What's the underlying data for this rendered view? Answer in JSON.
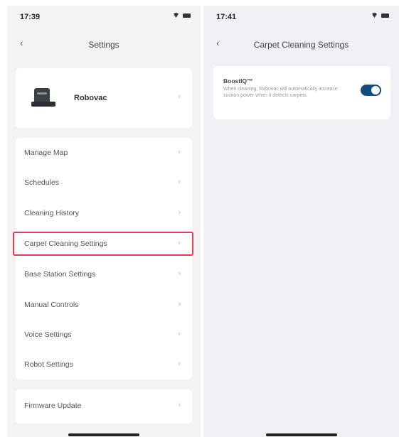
{
  "left": {
    "time": "17:39",
    "title": "Settings",
    "robot_name": "Robovac",
    "menu": [
      {
        "label": "Manage Map"
      },
      {
        "label": "Schedules"
      },
      {
        "label": "Cleaning History"
      },
      {
        "label": "Carpet Cleaning Settings",
        "highlighted": true
      },
      {
        "label": "Base Station Settings"
      },
      {
        "label": "Manual Controls"
      },
      {
        "label": "Voice Settings"
      },
      {
        "label": "Robot Settings"
      }
    ],
    "firmware_label": "Firmware Update"
  },
  "right": {
    "time": "17:41",
    "title": "Carpet Cleaning Settings",
    "boost": {
      "title": "BoostIQ™",
      "description": "When cleaning, Robovac will automatically increase suction power when it detects carpets.",
      "enabled": true
    }
  },
  "icons": {
    "back": "chevron-left-icon",
    "row_chevron": "chevron-right-icon",
    "wifi": "wifi-icon",
    "battery": "battery-icon"
  },
  "colors": {
    "highlight": "#e0404f",
    "toggle_on": "#174a7c"
  }
}
